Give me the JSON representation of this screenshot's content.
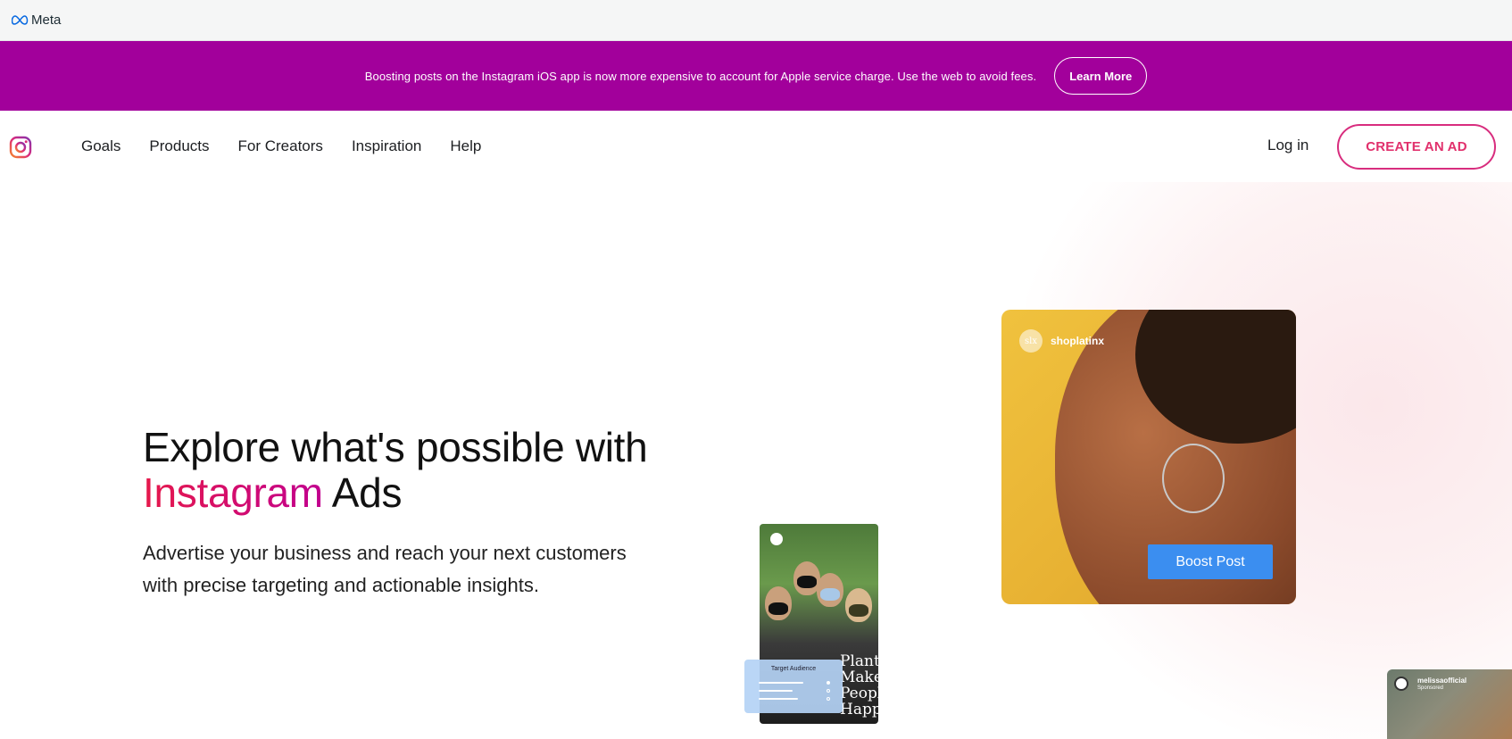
{
  "meta_bar": {
    "brand": "Meta"
  },
  "banner": {
    "text": "Boosting posts on the Instagram iOS app is now more expensive to account for Apple service charge. Use the web to avoid fees.",
    "button": "Learn More",
    "background": "#a2009b"
  },
  "nav": {
    "logo_icon": "instagram-logo-icon",
    "links": [
      "Goals",
      "Products",
      "For Creators",
      "Inspiration",
      "Help"
    ],
    "login": "Log in",
    "cta": "CREATE AN AD"
  },
  "hero": {
    "headline_part1": "Explore what's possible with",
    "headline_highlight": "Instagram",
    "headline_part2": "Ads",
    "subhead": "Advertise your business and reach your next customers with precise targeting and actionable insights.",
    "main_card": {
      "account": "shoplatinx",
      "avatar_text": "slx",
      "button": "Boost Post"
    },
    "phone_card": {
      "overlay_text": "Plants Make People Happy"
    },
    "target_card": {
      "title": "Target Audience"
    },
    "corner_card": {
      "account": "melissaofficial",
      "sub": "Sponsored"
    }
  },
  "colors": {
    "accent": "#e1306c",
    "boost_blue": "#3b8ef0"
  }
}
